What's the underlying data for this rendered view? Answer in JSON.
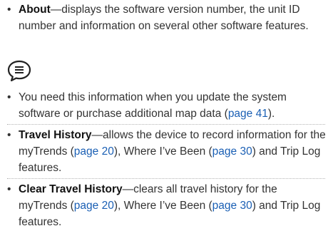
{
  "items": [
    {
      "term": "About",
      "text": "—displays the software version number, the unit ID number and information on several other software features."
    },
    {
      "icon": "note-icon",
      "text_before": "You need this information when you update the system software or purchase additional map data (",
      "link1": "page 41",
      "text_after": ")."
    },
    {
      "term": "Travel History",
      "text_before": "—allows the device to record information for the myTrends (",
      "link1": "page 20",
      "text_mid": "), Where I’ve Been (",
      "link2": "page 30",
      "text_after": ") and Trip Log features."
    },
    {
      "term": "Clear Travel History",
      "text_before": "—clears all travel history for the myTrends (",
      "link1": "page 20",
      "text_mid": "), Where I’ve Been (",
      "link2": "page 30",
      "text_after": ") and Trip Log features."
    }
  ],
  "colors": {
    "link": "#1a5fb4",
    "text": "#333333",
    "separator": "#b5b5b5"
  }
}
